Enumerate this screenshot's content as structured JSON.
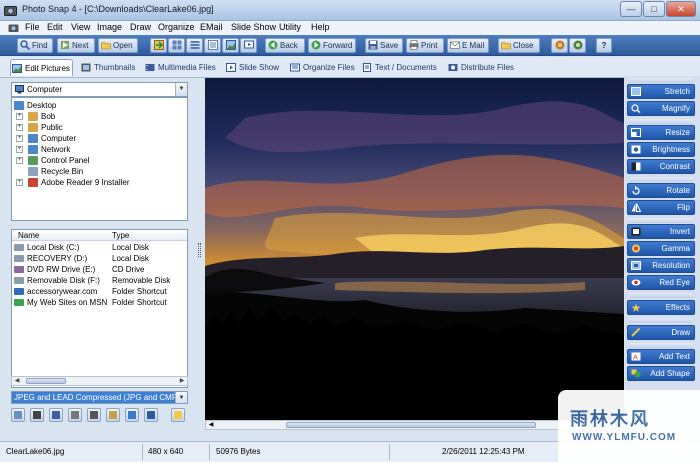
{
  "window": {
    "title": "Photo Snap 4 - [C:\\Downloads\\ClearLake06.jpg]",
    "buttons": {
      "minimize": "—",
      "maximize": "□",
      "close": "✕"
    }
  },
  "menu": [
    "File",
    "Edit",
    "View",
    "Image",
    "Draw",
    "Organize",
    "EMail",
    "Slide Show",
    "Utility",
    "Help"
  ],
  "toolbar": {
    "find": "Find",
    "next": "Next",
    "open": "Open",
    "back": "Back",
    "forward": "Forward",
    "save": "Save",
    "print": "Print",
    "email": "E Mail",
    "close": "Close",
    "help": "?"
  },
  "tabs": [
    "Edit Pictures",
    "Thumbnails",
    "Multimedia Files",
    "Slide Show",
    "Organize Files",
    "Text / Documents",
    "Distribute Files"
  ],
  "location": {
    "selected": "Computer"
  },
  "tree": [
    {
      "label": "Desktop",
      "expander": ""
    },
    {
      "label": "Bob",
      "expander": "+"
    },
    {
      "label": "Public",
      "expander": "+"
    },
    {
      "label": "Computer",
      "expander": "+"
    },
    {
      "label": "Network",
      "expander": "+"
    },
    {
      "label": "Control Panel",
      "expander": "+"
    },
    {
      "label": "Recycle Bin",
      "expander": ""
    },
    {
      "label": "Adobe Reader 9 Installer",
      "expander": "+"
    }
  ],
  "file_list": {
    "columns": {
      "name": "Name",
      "type": "Type"
    },
    "rows": [
      {
        "name": "Local Disk (C:)",
        "type": "Local Disk"
      },
      {
        "name": "RECOVERY (D:)",
        "type": "Local Disk"
      },
      {
        "name": "DVD RW Drive (E:)",
        "type": "CD Drive"
      },
      {
        "name": "Removable Disk (F:)",
        "type": "Removable Disk"
      },
      {
        "name": "accessorywear.com",
        "type": "Folder Shortcut"
      },
      {
        "name": "My Web Sites on MSN",
        "type": "Folder Shortcut"
      }
    ]
  },
  "filter": {
    "selected": "JPEG and LEAD Compressed (JPG and CMP)"
  },
  "side_buttons": {
    "stretch": "Stretch",
    "magnify": "Magnify",
    "resize": "Resize",
    "brightness": "Brightness",
    "contrast": "Contrast",
    "rotate": "Rotate",
    "flip": "Flip",
    "invert": "Invert",
    "gamma": "Gamma",
    "resolution": "Resolution",
    "redeye": "Red Eye",
    "effects": "Effects",
    "draw": "Draw",
    "addtext": "Add Text",
    "addshape": "Add Shape"
  },
  "status": {
    "filename": "ClearLake06.jpg",
    "dimensions": "480 x 640",
    "size": "50976 Bytes",
    "datetime": "2/26/2011 12:25:43 PM"
  },
  "watermark": {
    "big": "雨林木风",
    "url": "WWW.YLMFU.COM"
  },
  "colors": {
    "toolbar": "#2e5a9a",
    "side_button": "#1f56a8",
    "selection": "#3e7ed3"
  }
}
